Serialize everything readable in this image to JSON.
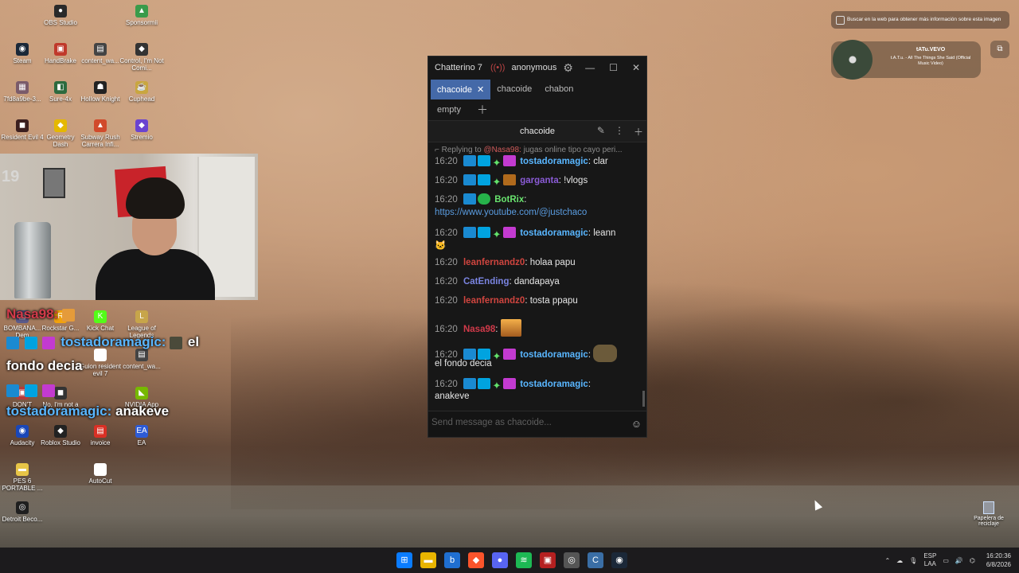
{
  "desktop": {
    "icons": [
      {
        "label": "OBS Studio",
        "glyph": "●",
        "color": "#2a2a2a"
      },
      {
        "label": "Sponsormii",
        "glyph": "▲",
        "color": "#3a9b4a"
      },
      {
        "label": "Steam",
        "glyph": "◉",
        "color": "#1b2838"
      },
      {
        "label": "HandBrake",
        "glyph": "▣",
        "color": "#c0392b"
      },
      {
        "label": "content_wa...",
        "glyph": "▤",
        "color": "#444444"
      },
      {
        "label": "Control, I'm Not Comi...",
        "glyph": "◆",
        "color": "#333333"
      },
      {
        "label": "7fd8a9be-3...",
        "glyph": "▦",
        "color": "#7a5b6a"
      },
      {
        "label": "Sure-4x",
        "glyph": "◧",
        "color": "#2d6a3e"
      },
      {
        "label": "Hollow Knight",
        "glyph": "☗",
        "color": "#222222"
      },
      {
        "label": "Cuphead",
        "glyph": "☕",
        "color": "#c9a640"
      },
      {
        "label": "Resident Evil 4",
        "glyph": "◼",
        "color": "#3b1f1f"
      },
      {
        "label": "Geometry Dash",
        "glyph": "◆",
        "color": "#e5b800"
      },
      {
        "label": "Subway Rush Carrera Infi...",
        "glyph": "▲",
        "color": "#d14a2b"
      },
      {
        "label": "Stremio",
        "glyph": "◆",
        "color": "#6a43d0"
      },
      {
        "label": "BOMBANA... Dem",
        "glyph": "▤",
        "color": "#5a5a8a"
      },
      {
        "label": "Rockstar G...",
        "glyph": "R",
        "color": "#f2a20c"
      },
      {
        "label": "Kick Chat",
        "glyph": "K",
        "color": "#53fc18"
      },
      {
        "label": "League of Legends",
        "glyph": "L",
        "color": "#c7a54a"
      },
      {
        "label": "Guion resident evil 7",
        "glyph": "▭",
        "color": "#ffffff"
      },
      {
        "label": "content_wa...",
        "glyph": "▤",
        "color": "#444444"
      },
      {
        "label": "DON'T",
        "glyph": "▣",
        "color": "#b43b3b"
      },
      {
        "label": "No, I'm not a",
        "glyph": "◼",
        "color": "#333333"
      },
      {
        "label": "NVIDIA App",
        "glyph": "◣",
        "color": "#76b900"
      },
      {
        "label": "Audacity",
        "glyph": "◉",
        "color": "#1a47b8"
      },
      {
        "label": "Roblox Studio",
        "glyph": "◆",
        "color": "#222222"
      },
      {
        "label": "invoice",
        "glyph": "▤",
        "color": "#d93025"
      },
      {
        "label": "EA",
        "glyph": "EA",
        "color": "#2d5bd6"
      },
      {
        "label": "PES 6 PORTABLE ...",
        "glyph": "▬",
        "color": "#e8c547"
      },
      {
        "label": "AutoCut",
        "glyph": "▤",
        "color": "#ffffff"
      },
      {
        "label": "Detroit Beco...",
        "glyph": "◎",
        "color": "#1f1f1f"
      }
    ],
    "recycle_bin": "Papelera de reciclaje"
  },
  "webcam": {
    "counter": "19"
  },
  "overlay_chat": {
    "line1_name": "Nasa98:",
    "line2_name": "tostadoramagic:",
    "line2_text": "el",
    "line3_text": "fondo decia",
    "line4_name": "tostadoramagic:",
    "line4_text": "anakeve",
    "colors": {
      "nasa98": "#d23a4a",
      "tostadoramagic": "#59b6ff"
    }
  },
  "chatterino": {
    "app_name": "Chatterino 7",
    "user": "anonymous",
    "tabs": [
      {
        "label": "chacoide",
        "active": true
      },
      {
        "label": "chacoide",
        "active": false
      },
      {
        "label": "chabon",
        "active": false
      }
    ],
    "tab_row2": "empty",
    "channel": "chacoide",
    "reply": {
      "prefix": "Replying to",
      "mention": "@Nasa98:",
      "text": "jugas online tipo cayo peri..."
    },
    "messages": [
      {
        "time": "16:20",
        "user": "tostadoramagic",
        "color": "#59b6ff",
        "text": ": clar"
      },
      {
        "time": "16:20",
        "user": "garganta",
        "color": "#8a5bd6",
        "text": ": !vlogs"
      },
      {
        "time": "16:20",
        "user": "BotRix",
        "color": "#68e36e",
        "text": ":"
      },
      {
        "time": "16:20",
        "user": "tostadoramagic",
        "color": "#59b6ff",
        "text": ": leann"
      },
      {
        "time": "16:20",
        "user": "leanfernandz0",
        "color": "#d0453f",
        "text": ": holaa papu"
      },
      {
        "time": "16:20",
        "user": "CatEnding",
        "color": "#7a84e0",
        "text": ": dandapaya"
      },
      {
        "time": "16:20",
        "user": "leanfernandz0",
        "color": "#d0453f",
        "text": ": tosta ppapu"
      },
      {
        "time": "16:20",
        "user": "Nasa98",
        "color": "#d23a4a",
        "text": ":"
      },
      {
        "time": "16:20",
        "user": "tostadoramagic",
        "color": "#59b6ff",
        "text": ":"
      },
      {
        "time": "16:20",
        "user": "tostadoramagic",
        "color": "#59b6ff",
        "text": ":"
      }
    ],
    "botrix_link": "https://www.youtube.com/@justchaco",
    "continuation_fondo": "el fondo decia",
    "continuation_anakeve": "anakeve",
    "input_placeholder": "Send message as chacoide..."
  },
  "widgets": {
    "search_text": "Buscar en la web para obtener más información sobre esta imagen",
    "media_title": "tATu.VEVO",
    "media_subtitle": "t.A.T.u. - All The Things She Said (Official Music Video)"
  },
  "taskbar": {
    "lang_top": "ESP",
    "lang_bottom": "LAA",
    "time": "16:20:36",
    "date": "6/8/2026",
    "accent": "#0a7cff"
  }
}
